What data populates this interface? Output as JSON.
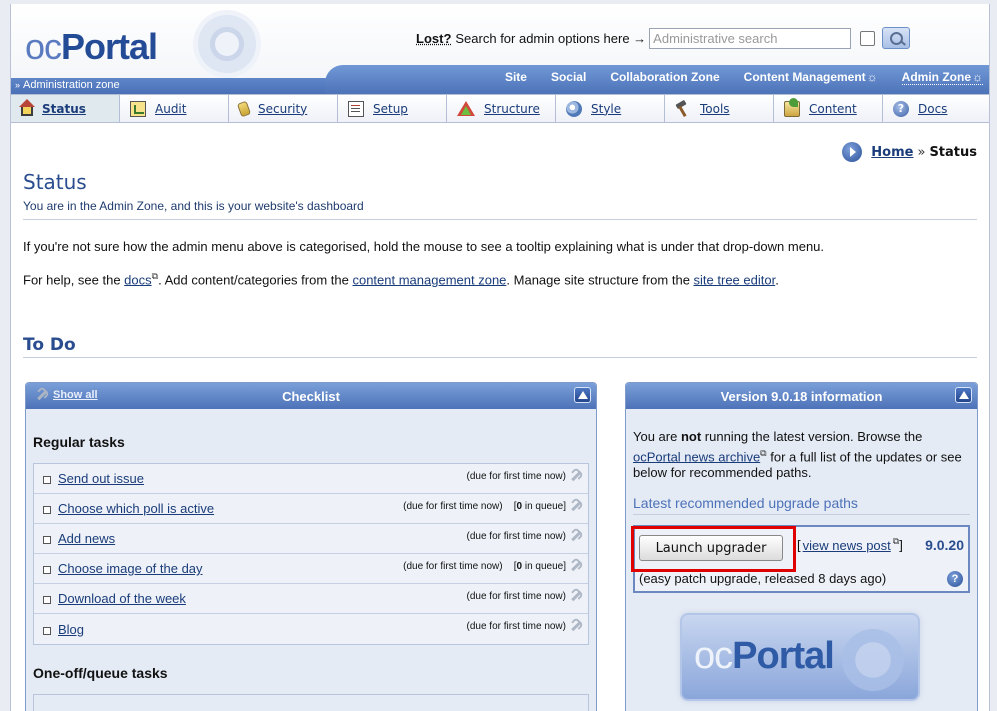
{
  "header": {
    "logo_oc": "oc",
    "logo_portal": "Portal",
    "lost_label": "Lost?",
    "search_prompt": "Search for admin options here →",
    "search_placeholder": "Administrative search"
  },
  "zonebar": {
    "zone_label": "Administration zone",
    "links": [
      "Site",
      "Social",
      "Collaboration Zone",
      "Content Management",
      "Admin Zone"
    ]
  },
  "menu": {
    "items": [
      {
        "label": "Status",
        "icon": "home-icon"
      },
      {
        "label": "Audit",
        "icon": "audit-icon"
      },
      {
        "label": "Security",
        "icon": "security-icon"
      },
      {
        "label": "Setup",
        "icon": "setup-icon"
      },
      {
        "label": "Structure",
        "icon": "structure-icon"
      },
      {
        "label": "Style",
        "icon": "style-icon"
      },
      {
        "label": "Tools",
        "icon": "tools-icon"
      },
      {
        "label": "Content",
        "icon": "content-icon"
      },
      {
        "label": "Docs",
        "icon": "docs-icon"
      }
    ]
  },
  "breadcrumb": {
    "home": "Home",
    "sep": "»",
    "current": "Status"
  },
  "main": {
    "title": "Status",
    "subtitle": "You are in the Admin Zone, and this is your website's dashboard",
    "para1": "If you're not sure how the admin menu above is categorised, hold the mouse to see a tooltip explaining what is under that drop-down menu.",
    "para2_a": "For help, see the ",
    "para2_docs": "docs",
    "para2_b": ". Add content/categories from the ",
    "para2_cmz": "content management zone",
    "para2_c": ". Manage site structure from the ",
    "para2_sitetree": "site tree editor",
    "para2_d": ".",
    "todo_heading": "To Do"
  },
  "checklist": {
    "title": "Checklist",
    "show_all": "Show all",
    "regular_title": "Regular tasks",
    "tasks": [
      {
        "label": "Send out issue",
        "due": "(due for first time now)",
        "queue": ""
      },
      {
        "label": "Choose which poll is active",
        "due": "(due for first time now)",
        "queue": "0"
      },
      {
        "label": "Add news",
        "due": "(due for first time now)",
        "queue": ""
      },
      {
        "label": "Choose image of the day",
        "due": "(due for first time now)",
        "queue": "0"
      },
      {
        "label": "Download of the week",
        "due": "(due for first time now)",
        "queue": ""
      },
      {
        "label": "Blog",
        "due": "(due for first time now)",
        "queue": ""
      }
    ],
    "queue_suffix": " in queue]",
    "oneoff_title": "One-off/queue tasks"
  },
  "version": {
    "title": "Version 9.0.18 information",
    "text_a": "You are ",
    "text_not": "not",
    "text_b": " running the latest version. Browse the ",
    "archive_link": "ocPortal news archive",
    "text_c": " for a full list of the updates or see below for recommended paths.",
    "paths_heading": "Latest recommended upgrade paths",
    "launch_label": "Launch upgrader",
    "news_post_link": "view news post",
    "version_number": "9.0.20",
    "upgrade_note": "(easy patch upgrade, released 8 days ago)"
  }
}
